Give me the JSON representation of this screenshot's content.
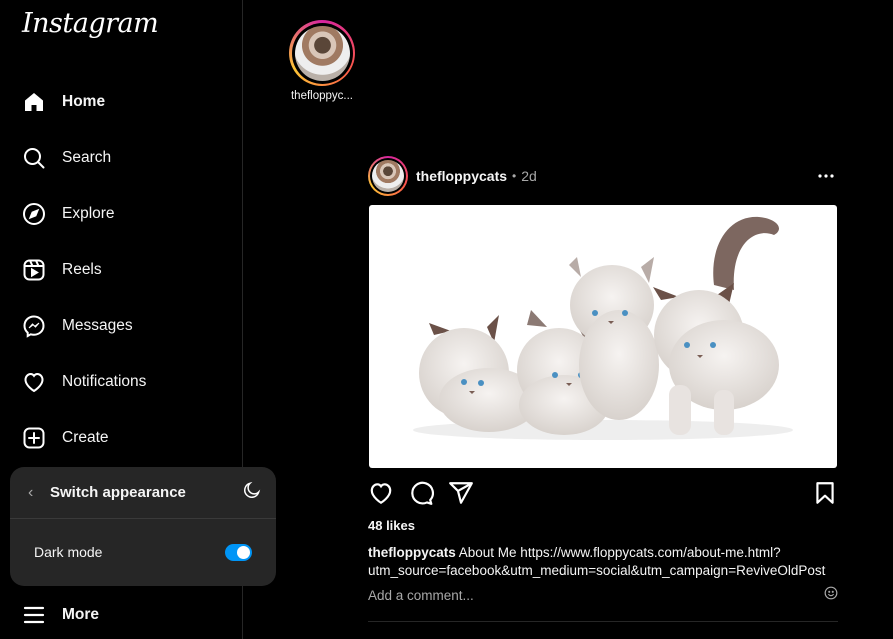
{
  "app": {
    "logo": "Instagram"
  },
  "sidebar": {
    "items": [
      {
        "label": "Home",
        "icon": "home-icon"
      },
      {
        "label": "Search",
        "icon": "search-icon"
      },
      {
        "label": "Explore",
        "icon": "compass-icon"
      },
      {
        "label": "Reels",
        "icon": "reels-icon"
      },
      {
        "label": "Messages",
        "icon": "messenger-icon"
      },
      {
        "label": "Notifications",
        "icon": "heart-icon"
      },
      {
        "label": "Create",
        "icon": "plus-square-icon"
      }
    ],
    "more_label": "More"
  },
  "appearance": {
    "title": "Switch appearance",
    "dark_mode_label": "Dark mode",
    "dark_mode_on": true
  },
  "stories": [
    {
      "username": "thefloppyc..."
    }
  ],
  "post": {
    "username": "thefloppycats",
    "separator": "•",
    "time": "2d",
    "likes": "48 likes",
    "caption_user": "thefloppycats",
    "caption_text": " About Me https://www.floppycats.com/about-me.html?utm_source=facebook&utm_medium=social&utm_campaign=ReviveOldPost",
    "comment_placeholder": "Add a comment..."
  },
  "colors": {
    "background": "#000000",
    "accent": "#0095f6",
    "panel": "#262626"
  }
}
